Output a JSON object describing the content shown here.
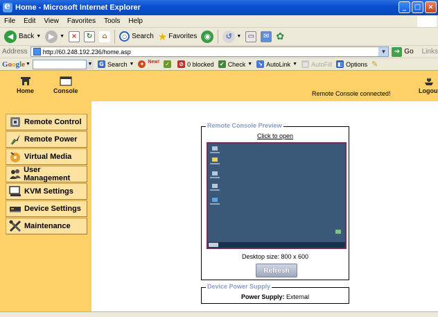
{
  "window": {
    "title": "Home - Microsoft Internet Explorer",
    "minimize_label": "_",
    "maximize_label": "□",
    "close_label": "×"
  },
  "menubar": {
    "items": [
      "File",
      "Edit",
      "View",
      "Favorites",
      "Tools",
      "Help"
    ]
  },
  "toolbar": {
    "back_label": "Back",
    "search_label": "Search",
    "favorites_label": "Favorites"
  },
  "address": {
    "label": "Address",
    "url": "http://60.248.192.236/home.asp",
    "go_label": "Go",
    "links_label": "Links"
  },
  "google_toolbar": {
    "logo": [
      "G",
      "o",
      "o",
      "g",
      "l",
      "e"
    ],
    "search_label": "Search",
    "new_badge": "New!",
    "blocked_label": "0 blocked",
    "check_label": "Check",
    "autolink_label": "AutoLink",
    "autofill_label": "AutoFill",
    "options_label": "Options"
  },
  "header": {
    "home_label": "Home",
    "console_label": "Console",
    "status_text": "Remote Console connected!",
    "logout_label": "Logout",
    "background_color": "#fdd068"
  },
  "sidebar": {
    "items": [
      {
        "label": "Remote Control",
        "icon": "remote-control-icon"
      },
      {
        "label": "Remote Power",
        "icon": "lightning-icon"
      },
      {
        "label": "Virtual Media",
        "icon": "disc-icon"
      },
      {
        "label": "User Management",
        "icon": "users-icon"
      },
      {
        "label": "KVM Settings",
        "icon": "kvm-monitor-icon"
      },
      {
        "label": "Device Settings",
        "icon": "device-icon"
      },
      {
        "label": "Maintenance",
        "icon": "tools-icon"
      }
    ]
  },
  "preview": {
    "legend": "Remote Console Preview",
    "click_text": "Click to open",
    "desktop_size": "Desktop size: 800 x 600",
    "refresh_label": "Refresh"
  },
  "power": {
    "legend": "Device Power Supply",
    "label": "Power Supply:",
    "value": "External"
  }
}
